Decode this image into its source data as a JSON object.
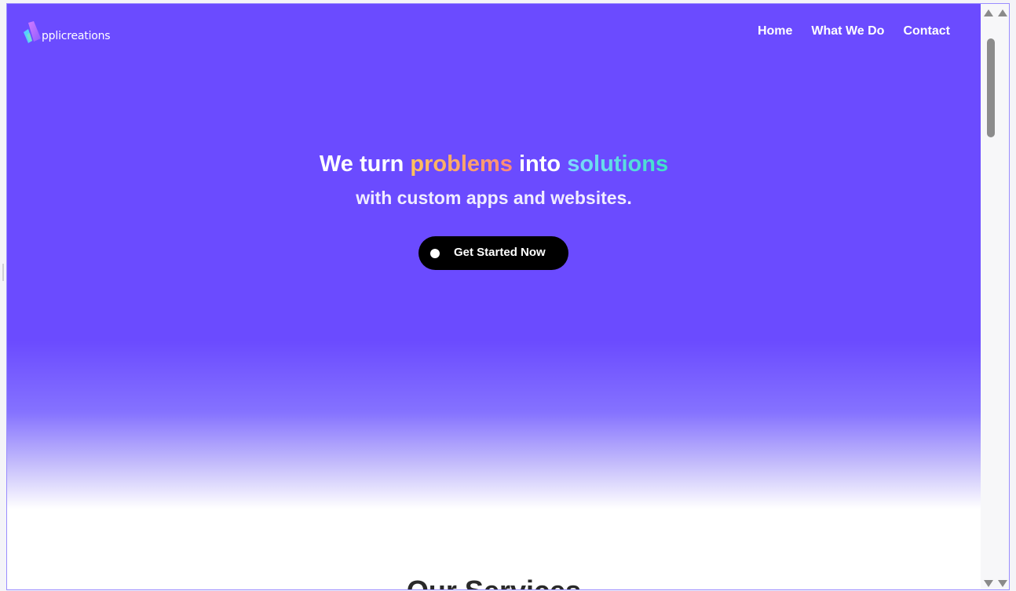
{
  "brand": {
    "logo_text": "pplicreations",
    "colors": {
      "hero": "#6b4bff",
      "problems_gradient": [
        "#ffc35a",
        "#ff8a7a"
      ],
      "solutions_gradient": [
        "#7fd8ff",
        "#3fe0c8"
      ],
      "cta": "#000000"
    }
  },
  "nav": {
    "items": [
      {
        "label": "Home"
      },
      {
        "label": "What We Do"
      },
      {
        "label": "Contact"
      }
    ]
  },
  "hero": {
    "headline": {
      "part1": "We turn ",
      "highlight1": "problems",
      "part2": " into ",
      "highlight2": "solutions"
    },
    "subline": "with custom apps and websites.",
    "cta_label": "Get Started Now"
  },
  "services": {
    "title": "Our Services"
  },
  "icons": {
    "logo": "app-logo-icon",
    "cta_dot": "dot-icon",
    "scroll_up": "arrow-up-icon",
    "scroll_down": "arrow-down-icon"
  }
}
